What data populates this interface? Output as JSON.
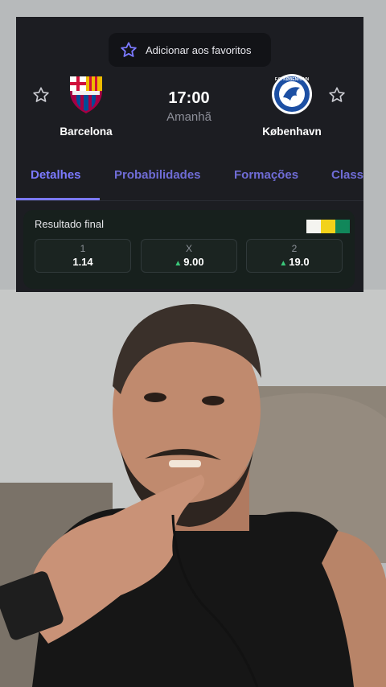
{
  "favorite": {
    "label": "Adicionar aos favoritos"
  },
  "match": {
    "home": {
      "name": "Barcelona",
      "crest": "barcelona-crest"
    },
    "away": {
      "name": "København",
      "crest": "kobenhavn-crest",
      "crest_text": "F.C. KØBENHAVN"
    },
    "time": "17:00",
    "day": "Amanhã"
  },
  "tabs": [
    {
      "label": "Detalhes",
      "active": true
    },
    {
      "label": "Probabilidades",
      "active": false
    },
    {
      "label": "Formações",
      "active": false
    },
    {
      "label": "Class",
      "active": false
    }
  ],
  "odds": {
    "title": "Resultado final",
    "bookmaker_colors": [
      "#f4f4f0",
      "#f2d21a",
      "#11875a"
    ],
    "options": [
      {
        "label": "1",
        "value": "1.14",
        "trend": "none"
      },
      {
        "label": "X",
        "value": "9.00",
        "trend": "up"
      },
      {
        "label": "2",
        "value": "19.0",
        "trend": "up"
      }
    ]
  },
  "colors": {
    "accent": "#7b79ff",
    "card_bg": "#1c1d22",
    "trend_up": "#3bc77a"
  },
  "icons": [
    "star-icon",
    "barcelona-crest",
    "kobenhavn-crest",
    "trend-up-icon"
  ]
}
